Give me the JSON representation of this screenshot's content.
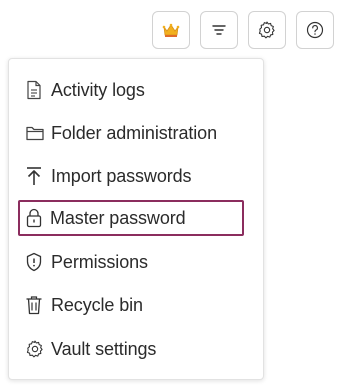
{
  "toolbar": {
    "buttons": [
      {
        "name": "crown-icon",
        "accent": "#f2b01e"
      },
      {
        "name": "filter-icon"
      },
      {
        "name": "gear-icon"
      },
      {
        "name": "help-icon"
      }
    ]
  },
  "menu": {
    "items": [
      {
        "label": "Activity logs",
        "icon": "document-icon"
      },
      {
        "label": "Folder administration",
        "icon": "folder-icon"
      },
      {
        "label": "Import passwords",
        "icon": "import-icon"
      },
      {
        "label": "Master password",
        "icon": "lock-icon",
        "selected": true
      },
      {
        "label": "Permissions",
        "icon": "shield-icon"
      },
      {
        "label": "Recycle bin",
        "icon": "trash-icon"
      },
      {
        "label": "Vault settings",
        "icon": "gear-icon"
      }
    ],
    "highlight_color": "#8b2d5e"
  }
}
